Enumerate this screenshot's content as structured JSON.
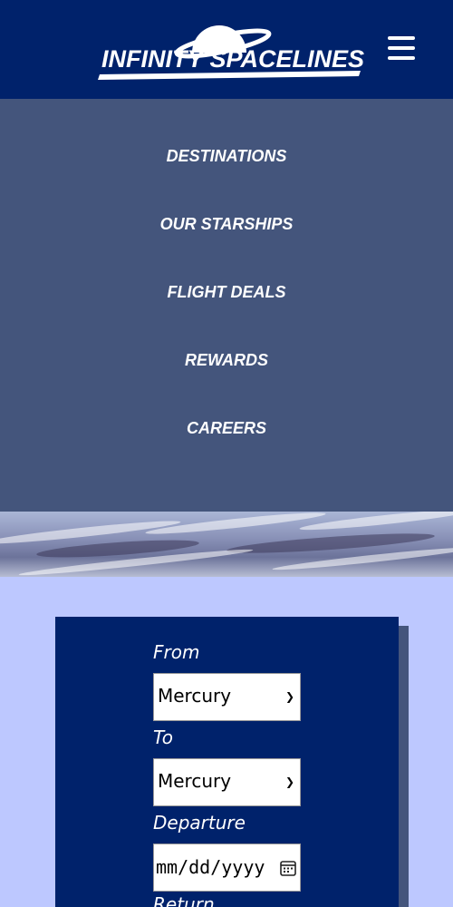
{
  "header": {
    "brand": "INFINITY SPACELINES",
    "brand_color": "#00226b",
    "menu_icon": "hamburger-icon"
  },
  "nav": {
    "items": [
      {
        "label": "DESTINATIONS"
      },
      {
        "label": "OUR STARSHIPS"
      },
      {
        "label": "FLIGHT DEALS"
      },
      {
        "label": "REWARDS"
      },
      {
        "label": "CAREERS"
      }
    ],
    "bg_color": "#44557c"
  },
  "booking": {
    "from_label": "From",
    "from_value": "Mercury",
    "to_label": "To",
    "to_value": "Mercury",
    "departure_label": "Departure",
    "departure_placeholder": "mm/dd/yyyy",
    "return_label": "Return"
  }
}
